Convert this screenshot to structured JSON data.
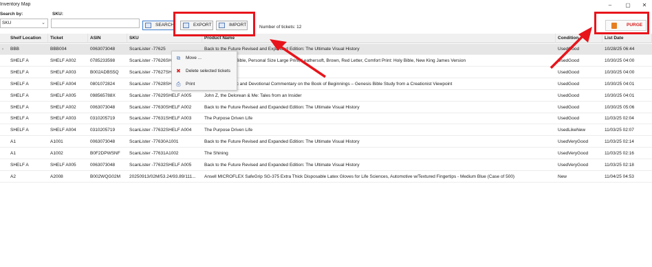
{
  "window": {
    "title": "Inventory Map",
    "minimize": "–",
    "maximize": "▢",
    "close": "✕"
  },
  "search": {
    "search_by_label": "Search by:",
    "search_by_value": "SKU",
    "sku_label": "SKU:",
    "sku_value": ""
  },
  "toolbar": {
    "search_label": "SEARCH",
    "export_label": "EXPORT",
    "import_label": "IMPORT",
    "ticket_count": "Number of tickets: 12",
    "purge_label": "PURGE"
  },
  "colors": {
    "highlight": "#e8141b",
    "purge_text": "#d81b1b",
    "selected_row": "#e6e6e6"
  },
  "table": {
    "columns": [
      "Shelf Location",
      "Ticket",
      "ASIN",
      "SKU",
      "Product Name",
      "Condition",
      "List Date"
    ],
    "rows": [
      [
        "BBB",
        "BBB004",
        "0063073048",
        "ScanLister -77625",
        "Back to the Future Revised and Expanded Edition: The Ultimate Visual History",
        "UsedGood",
        "10/28/25 06:44"
      ],
      [
        "SHELF A",
        "SHELF A002",
        "0785233598",
        "ScanLister -77626SH",
        "...se Reference Bible, Personal Size Large Print, Leathersoft, Brown, Red Letter, Comfort Print: Holy Bible, New King James Version",
        "UsedGood",
        "10/30/25 04:00"
      ],
      [
        "SHELF A",
        "SHELF A003",
        "B002ADBS5Q",
        "ScanLister -77627SH",
        "",
        "UsedGood",
        "10/30/25 04:00"
      ],
      [
        "SHELF A",
        "SHELF A004",
        "0801072824",
        "ScanLister -77628SH",
        "...ord: A Scientific and Devotional Commentary on the Book of Beginnings – Genesis Bible Study from a Creationist Viewpoint",
        "UsedGood",
        "10/30/25 04:01"
      ],
      [
        "SHELF A",
        "SHELF A005",
        "098565788X",
        "ScanLister -77629SHELF A005",
        "John Z, the Delorean & Me: Tales from an Insider",
        "UsedGood",
        "10/30/25 04:01"
      ],
      [
        "SHELF A",
        "SHELF A002",
        "0063073048",
        "ScanLister -77630SHELF A002",
        "Back to the Future Revised and Expanded Edition: The Ultimate Visual History",
        "UsedGood",
        "10/30/25 05:06"
      ],
      [
        "SHELF A",
        "SHELF A003",
        "0310205719",
        "ScanLister -77631SHELF A003",
        "The Purpose Driven Life",
        "UsedGood",
        "11/03/25 02:04"
      ],
      [
        "SHELF A",
        "SHELF A004",
        "0310205719",
        "ScanLister -77632SHELF A004",
        "The Purpose Driven Life",
        "UsedLikeNew",
        "11/03/25 02:07"
      ],
      [
        "A1",
        "A1001",
        "0063073048",
        "ScanLister -77630A1001",
        "Back to the Future Revised and Expanded Edition: The Ultimate Visual History",
        "UsedVeryGood",
        "11/03/25 02:14"
      ],
      [
        "A1",
        "A1002",
        "B0F2DPWSNF",
        "ScanLister -77631A1002",
        "The Shining",
        "UsedVeryGood",
        "11/03/25 02:16"
      ],
      [
        "SHELF A",
        "SHELF A005",
        "0063073048",
        "ScanLister -77632SHELF A005",
        "Back to the Future Revised and Expanded Edition: The Ultimate Visual History",
        "UsedVeryGood",
        "11/03/25 02:18"
      ],
      [
        "A2",
        "A2008",
        "B002WQG02M",
        "20250913/02M/53.24/93.89/111...",
        "Ansell MICROFLEX SafeGrip SG-375 Extra Thick Disposable Latex Gloves for Life Sciences, Automotive w/Textured Fingertips - Medium Blue (Case of 500)",
        "New",
        "11/04/25 04:53"
      ]
    ]
  },
  "context_menu": {
    "items": [
      {
        "label": "Move ...",
        "icon": "move-icon"
      },
      {
        "label": "Delete selected tickets",
        "icon": "delete-icon"
      },
      {
        "label": "Print",
        "icon": "print-icon"
      }
    ]
  }
}
